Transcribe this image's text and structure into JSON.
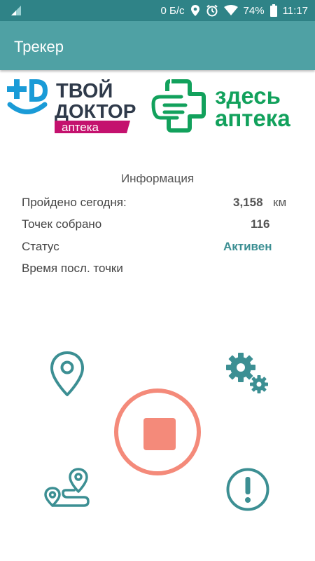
{
  "status_bar": {
    "network": "0 Б/с",
    "battery": "74%",
    "time": "11:17",
    "icons": [
      "signal-icon",
      "location-icon",
      "alarm-icon",
      "wifi-icon",
      "battery-icon"
    ]
  },
  "app_bar": {
    "title": "Трекер"
  },
  "logos": {
    "left": {
      "line1": "ТВОЙ",
      "line2": "ДОКТОР",
      "badge": "аптека",
      "mark": "+D"
    },
    "right": {
      "line1": "здесь",
      "line2": "аптека"
    }
  },
  "info": {
    "title": "Информация",
    "rows": [
      {
        "label": "Пройдено сегодня:",
        "value": "3,158",
        "unit": "км"
      },
      {
        "label": "Точек собрано",
        "value": "116"
      },
      {
        "label": "Статус",
        "value": "Активен"
      },
      {
        "label": "Время посл. точки",
        "value": ""
      }
    ]
  },
  "controls": {
    "location": "map-pin-icon",
    "settings": "gears-icon",
    "stop": "stop-icon",
    "route": "route-icon",
    "alert": "exclamation-icon"
  },
  "colors": {
    "status_bar": "#2f8387",
    "app_bar": "#4fa1a4",
    "accent": "#3c8f93",
    "stop": "#f48a7a",
    "logo_blue": "#1a9bd7",
    "logo_dark": "#2f3a4a",
    "logo_magenta": "#c4116e",
    "logo_green": "#12a15c"
  }
}
